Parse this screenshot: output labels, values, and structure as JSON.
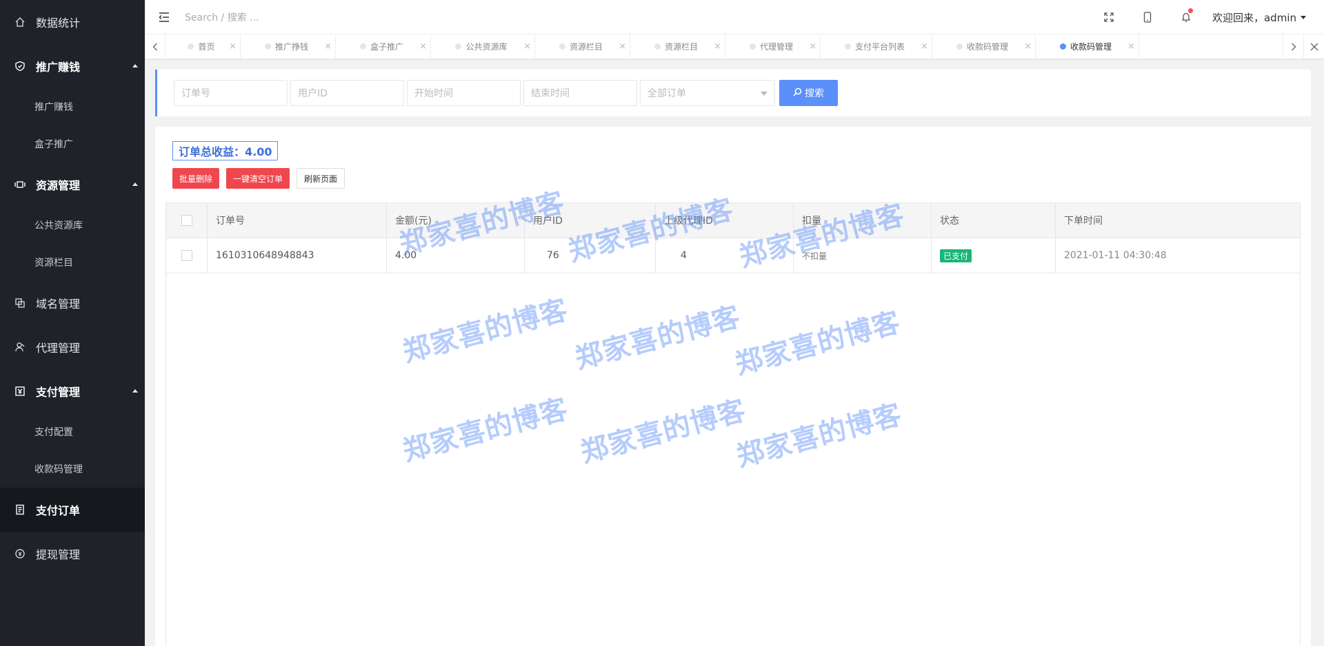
{
  "sidebar": {
    "items": [
      {
        "label": "数据统计",
        "icon": "home-icon"
      },
      {
        "label": "推广赚钱",
        "icon": "shield-icon",
        "expanded": true,
        "children": [
          {
            "label": "推广赚钱"
          },
          {
            "label": "盒子推广"
          }
        ]
      },
      {
        "label": "资源管理",
        "icon": "resource-icon",
        "expanded": true,
        "children": [
          {
            "label": "公共资源库"
          },
          {
            "label": "资源栏目"
          }
        ]
      },
      {
        "label": "域名管理",
        "icon": "domain-icon"
      },
      {
        "label": "代理管理",
        "icon": "agent-icon"
      },
      {
        "label": "支付管理",
        "icon": "payment-icon",
        "expanded": true,
        "children": [
          {
            "label": "支付配置"
          },
          {
            "label": "收款码管理"
          }
        ]
      },
      {
        "label": "支付订单",
        "icon": "order-icon",
        "active": true
      },
      {
        "label": "提现管理",
        "icon": "withdraw-icon"
      }
    ]
  },
  "header": {
    "search_placeholder": "Search / 搜索 ...",
    "welcome": "欢迎回来，admin"
  },
  "tabs": [
    {
      "label": "首页"
    },
    {
      "label": "推广挣钱"
    },
    {
      "label": "盒子推广"
    },
    {
      "label": "公共资源库"
    },
    {
      "label": "资源栏目"
    },
    {
      "label": "资源栏目"
    },
    {
      "label": "代理管理"
    },
    {
      "label": "支付平台列表"
    },
    {
      "label": "收款码管理"
    },
    {
      "label": "收款码管理",
      "active": true
    }
  ],
  "filters": {
    "order_no_placeholder": "订单号",
    "user_id_placeholder": "用户ID",
    "start_time_placeholder": "开始时间",
    "end_time_placeholder": "结束时间",
    "status_select": "全部订单",
    "search_button": "搜索"
  },
  "summary": {
    "total_label": "订单总收益：4.00"
  },
  "actions": {
    "batch_delete": "批量删除",
    "clear_orders": "一键清空订单",
    "refresh": "刷新页面"
  },
  "table": {
    "columns": [
      "订单号",
      "金额(元)",
      "用户ID",
      "上级代理ID",
      "扣量",
      "状态",
      "下单时间"
    ],
    "rows": [
      {
        "order_no": "1610310648948843",
        "amount": "4.00",
        "user_id": "76",
        "parent_agent_id": "4",
        "deduct": "不扣量",
        "status": "已支付",
        "time": "2021-01-11 04:30:48"
      }
    ]
  },
  "watermark": "郑家喜的博客",
  "colors": {
    "sidebar_bg": "#20222a",
    "accent": "#5b8ff9",
    "danger": "#f0464d",
    "success": "#16b777"
  }
}
